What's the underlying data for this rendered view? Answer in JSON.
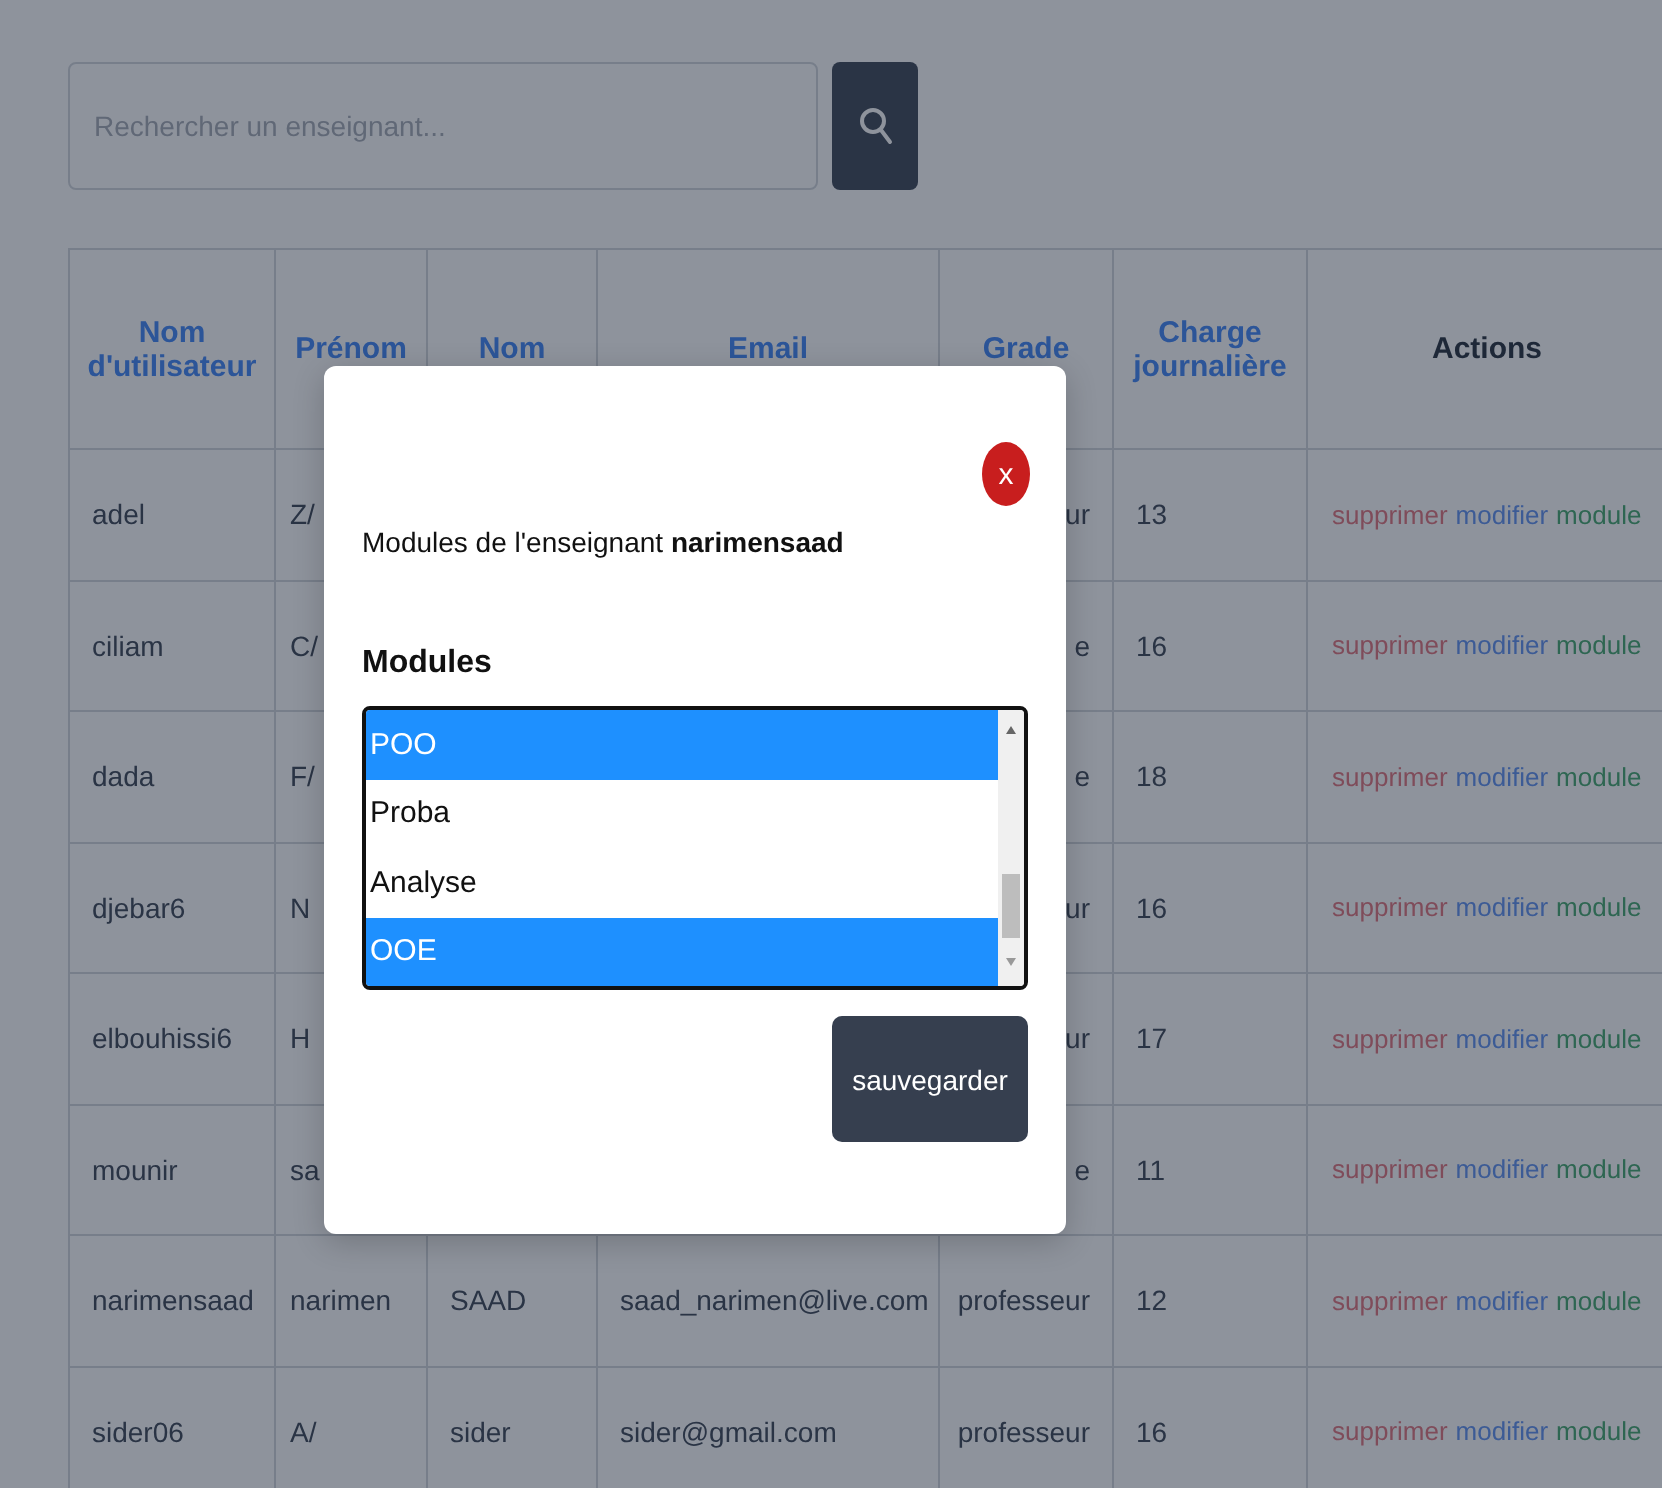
{
  "search": {
    "placeholder": "Rechercher un enseignant..."
  },
  "table": {
    "columns": [
      "Nom d'utilisateur",
      "Prénom",
      "Nom",
      "Email",
      "Grade",
      "Charge journalière",
      "Actions"
    ],
    "rows": [
      {
        "username": "adel",
        "first_name": "Z/",
        "grade": "ur",
        "daily_load": "13",
        "actions": [
          {
            "kind": "delete",
            "label": "supprimer"
          },
          {
            "kind": "edit",
            "label": "modifier"
          },
          {
            "kind": "modules",
            "label": "module"
          }
        ]
      },
      {
        "username": "ciliam",
        "first_name": "C/",
        "grade": "e",
        "daily_load": "16",
        "actions": [
          {
            "kind": "delete",
            "label": "supprimer"
          },
          {
            "kind": "edit",
            "label": "modifier"
          },
          {
            "kind": "modules",
            "label": "module"
          }
        ]
      },
      {
        "username": "dada",
        "first_name": "F/",
        "grade": "e",
        "daily_load": "18",
        "actions": [
          {
            "kind": "delete",
            "label": "supprimer"
          },
          {
            "kind": "edit",
            "label": "modifier"
          },
          {
            "kind": "modules",
            "label": "module"
          }
        ]
      },
      {
        "username": "djebar6",
        "first_name": "N",
        "grade": "ur",
        "daily_load": "16",
        "actions": [
          {
            "kind": "delete",
            "label": "supprimer"
          },
          {
            "kind": "edit",
            "label": "modifier"
          },
          {
            "kind": "modules",
            "label": "module"
          }
        ]
      },
      {
        "username": "elbouhissi6",
        "first_name": "H",
        "grade": "ur",
        "daily_load": "17",
        "actions": [
          {
            "kind": "delete",
            "label": "supprimer"
          },
          {
            "kind": "edit",
            "label": "modifier"
          },
          {
            "kind": "modules",
            "label": "module"
          }
        ]
      },
      {
        "username": "mounir",
        "first_name": "sa",
        "grade": "e",
        "daily_load": "11",
        "actions": [
          {
            "kind": "delete",
            "label": "supprimer"
          },
          {
            "kind": "edit",
            "label": "modifier"
          },
          {
            "kind": "modules",
            "label": "module"
          }
        ]
      },
      {
        "username": "narimensaad",
        "first_name": "narimen",
        "last_name": "SAAD",
        "email": "saad_narimen@live.com",
        "grade": "professeur",
        "daily_load": "12",
        "actions": [
          {
            "kind": "delete",
            "label": "supprimer"
          },
          {
            "kind": "edit",
            "label": "modifier"
          },
          {
            "kind": "modules",
            "label": "module"
          }
        ]
      },
      {
        "username": "sider06",
        "first_name": "A/",
        "last_name": "sider",
        "email": "sider@gmail.com",
        "grade": "professeur",
        "daily_load": "16",
        "actions": [
          {
            "kind": "delete",
            "label": "supprimer"
          },
          {
            "kind": "edit",
            "label": "modifier"
          },
          {
            "kind": "modules",
            "label": "module"
          }
        ]
      }
    ]
  },
  "modal": {
    "close_label": "x",
    "heading": "Modules de l'enseignant **narimensaad**",
    "field_label": "Modules",
    "options": [
      {
        "label": "POO",
        "selected": true
      },
      {
        "label": "Proba",
        "selected": false
      },
      {
        "label": "Analyse",
        "selected": false
      },
      {
        "label": "OOE",
        "selected": true
      }
    ],
    "save_button": "sauvegarder"
  }
}
